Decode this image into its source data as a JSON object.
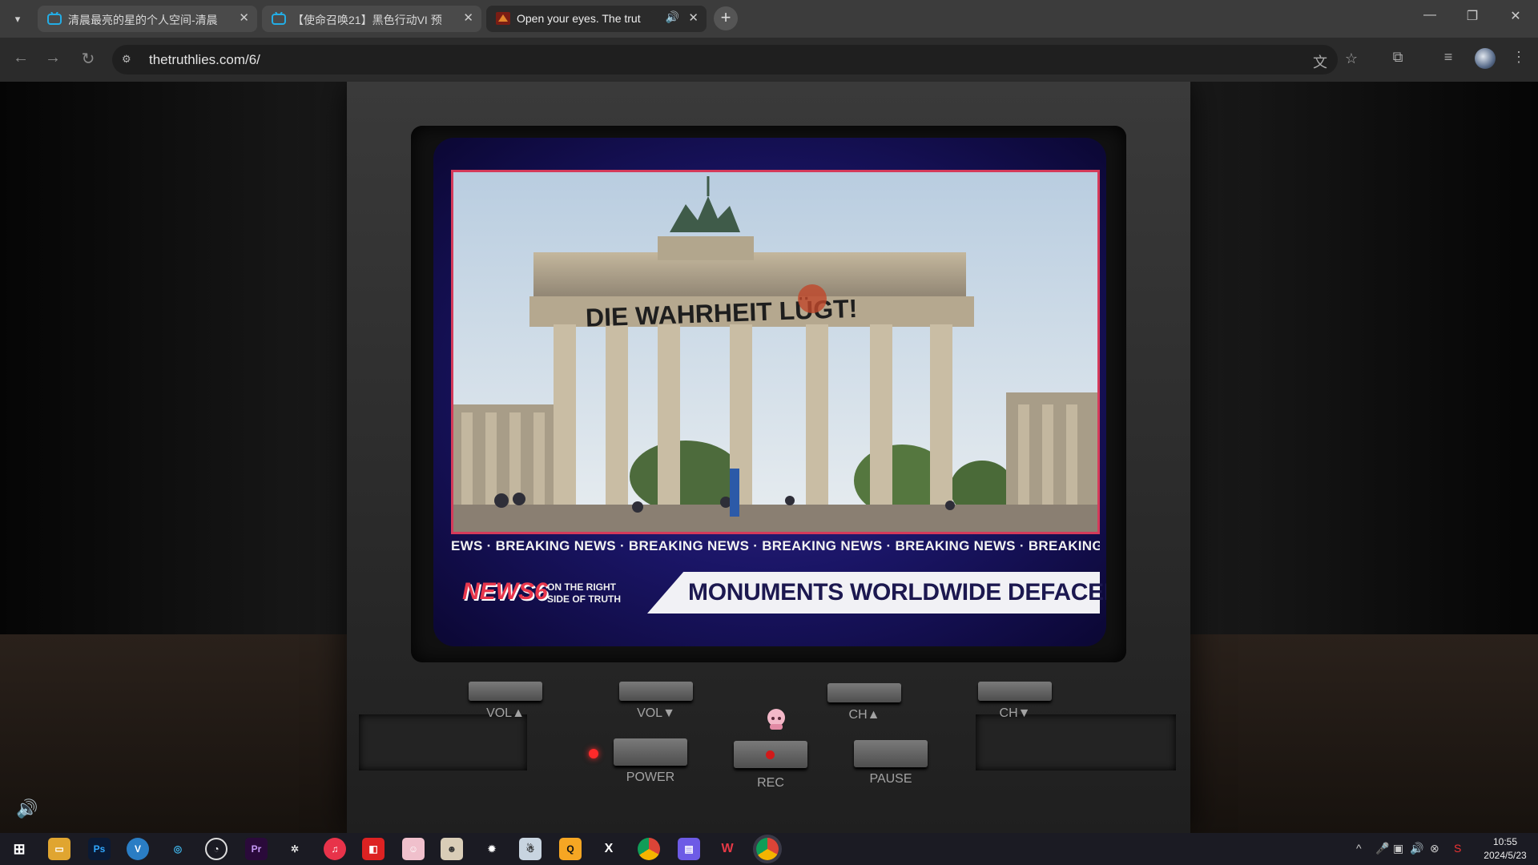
{
  "browser": {
    "tabs": [
      {
        "title": "清晨最亮的星的个人空间-清晨",
        "active": false,
        "favicon": "bilibili-icon"
      },
      {
        "title": "【使命召唤21】黑色行动VI 预",
        "active": false,
        "favicon": "bilibili-icon"
      },
      {
        "title": "Open your eyes. The trut",
        "active": true,
        "favicon": "site-icon",
        "audio": true
      }
    ],
    "url": "thetruthlies.com/6/",
    "accent": "#2b2b2b"
  },
  "page": {
    "graffiti": "DIE WAHRHEIT LÜGT!",
    "ticker": "EWS  ·  BREAKING NEWS  ·  BREAKING NEWS  ·  BREAKING NEWS  ·  BREAKING NEWS  ·  BREAKING NEWS  ·  BREAKI",
    "logo": "NEWS6",
    "tagline": "ON THE RIGHT SIDE OF TRUTH",
    "headline": "MONUMENTS WORLDWIDE DEFACED",
    "buttons": {
      "vol_up": "VOL▲",
      "vol_down": "VOL▼",
      "ch_up": "CH▲",
      "ch_down": "CH▼",
      "power": "POWER",
      "rec": "REC",
      "pause": "PAUSE"
    }
  },
  "taskbar": {
    "time": "10:55",
    "date": "2024/5/23"
  }
}
